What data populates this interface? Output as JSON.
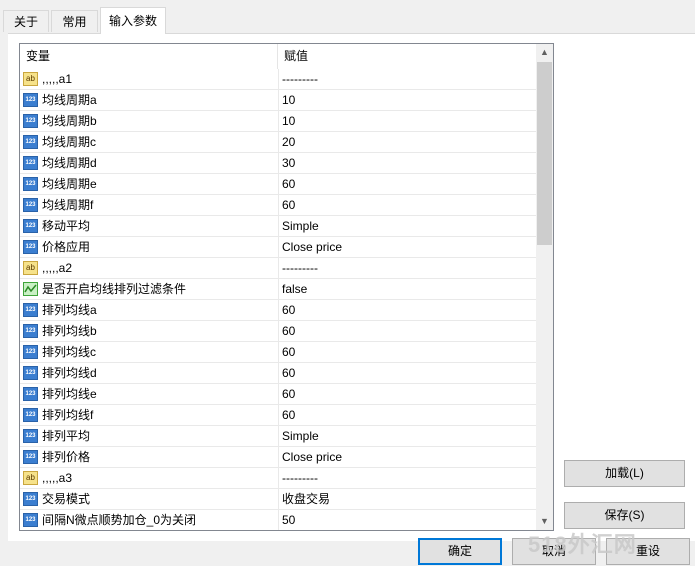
{
  "tabs": [
    "关于",
    "常用",
    "输入参数"
  ],
  "table": {
    "headers": [
      "变量",
      "赋值"
    ],
    "rows": [
      {
        "type": "str",
        "name": ",,,,,a1",
        "value": "---------"
      },
      {
        "type": "num",
        "name": "均线周期a",
        "value": "10"
      },
      {
        "type": "num",
        "name": "均线周期b",
        "value": "10"
      },
      {
        "type": "num",
        "name": "均线周期c",
        "value": "20"
      },
      {
        "type": "num",
        "name": "均线周期d",
        "value": "30"
      },
      {
        "type": "num",
        "name": "均线周期e",
        "value": "60"
      },
      {
        "type": "num",
        "name": "均线周期f",
        "value": "60"
      },
      {
        "type": "num",
        "name": "移动平均",
        "value": "Simple"
      },
      {
        "type": "num",
        "name": "价格应用",
        "value": "Close price"
      },
      {
        "type": "str",
        "name": ",,,,,a2",
        "value": "---------"
      },
      {
        "type": "bool",
        "name": "是否开启均线排列过滤条件",
        "value": "false"
      },
      {
        "type": "num",
        "name": "排列均线a",
        "value": "60"
      },
      {
        "type": "num",
        "name": "排列均线b",
        "value": "60"
      },
      {
        "type": "num",
        "name": "排列均线c",
        "value": "60"
      },
      {
        "type": "num",
        "name": "排列均线d",
        "value": "60"
      },
      {
        "type": "num",
        "name": "排列均线e",
        "value": "60"
      },
      {
        "type": "num",
        "name": "排列均线f",
        "value": "60"
      },
      {
        "type": "num",
        "name": "排列平均",
        "value": "Simple"
      },
      {
        "type": "num",
        "name": "排列价格",
        "value": "Close price"
      },
      {
        "type": "str",
        "name": ",,,,,a3",
        "value": "---------"
      },
      {
        "type": "num",
        "name": "交易模式",
        "value": "收盘交易"
      },
      {
        "type": "num",
        "name": "间隔N微点顺势加仓_0为关闭",
        "value": "50"
      }
    ]
  },
  "icons": {
    "num": "123",
    "str": "ab",
    "bool": "bool-icon"
  },
  "buttons": {
    "load": "加载(L)",
    "save": "保存(S)",
    "ok": "确定",
    "cancel": "取消",
    "reset": "重设"
  },
  "watermark": "518外汇网"
}
